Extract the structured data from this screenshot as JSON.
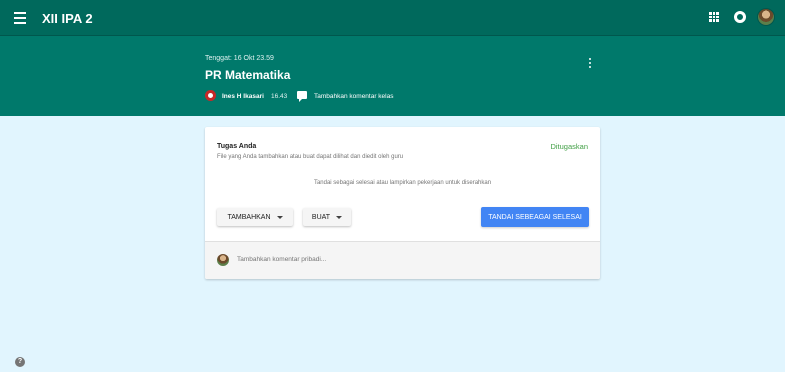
{
  "topbar": {
    "class_name": "XII IPA 2",
    "menu_icon": "hamburger-icon",
    "apps_icon": "apps-grid-icon",
    "notif_icon": "notification-icon",
    "avatar_icon": "user-avatar"
  },
  "assignment": {
    "due": "Tenggat: 16 Okt 23.59",
    "title": "PR Matematika",
    "author": "Ines H Ikasari",
    "time": "16.43",
    "class_comment": "Tambahkan komentar kelas"
  },
  "work": {
    "title": "Tugas Anda",
    "status": "Ditugaskan",
    "description": "File yang Anda tambahkan atau buat dapat dilihat dan diedit oleh guru",
    "hint": "Tandai sebagai selesai atau lampirkan pekerjaan untuk diserahkan",
    "add_label": "TAMBAHKAN",
    "create_label": "BUAT",
    "done_label": "TANDAI SEBEAGAI SELESAI",
    "private_comment_placeholder": "Tambahkan komentar pribadi..."
  },
  "colors": {
    "topbar": "#00695c",
    "header": "#00796b",
    "background": "#e1f5fe",
    "status_green": "#43a047",
    "primary_button": "#4285f4"
  }
}
